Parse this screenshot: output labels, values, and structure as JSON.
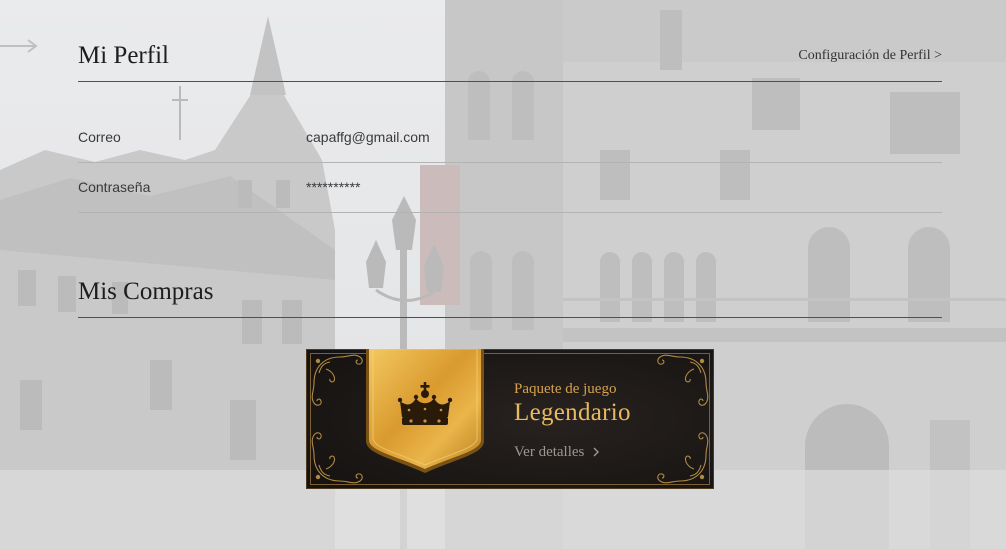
{
  "profile": {
    "title": "Mi Perfil",
    "settings_link": "Configuración de Perfil >",
    "fields": [
      {
        "label": "Correo",
        "value": "capaffg@gmail.com"
      },
      {
        "label": "Contraseña",
        "value": "**********"
      }
    ]
  },
  "purchases": {
    "title": "Mis Compras",
    "card": {
      "subtitle": "Paquete de juego",
      "title": "Legendario",
      "details_link": "Ver detalles"
    }
  },
  "icons": {
    "card_badge": "crown-icon",
    "details_chevron": "chevron-right-icon"
  },
  "colors": {
    "text": "#1d1d1d",
    "divider": "#505050",
    "card_background": "#1c1816",
    "accent_gold": "#d6a24c",
    "details_text": "#9d9893"
  }
}
